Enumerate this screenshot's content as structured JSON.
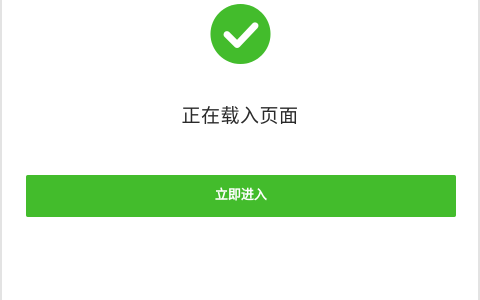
{
  "status": {
    "icon": "check-circle-icon",
    "message": "正在载入页面"
  },
  "actions": {
    "enter_label": "立即进入"
  },
  "colors": {
    "success": "#43bc2c",
    "button": "#43bc2c",
    "text": "#2a2a2a",
    "background": "#ffffff"
  }
}
